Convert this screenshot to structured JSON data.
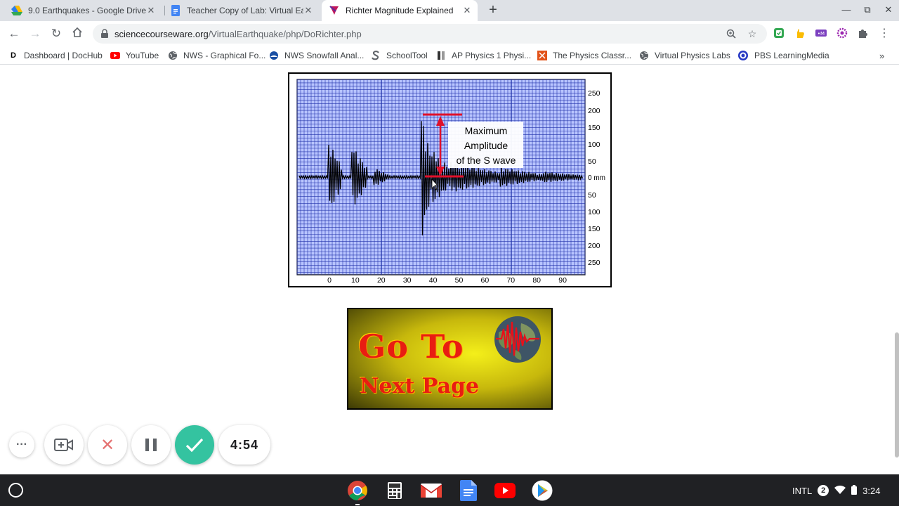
{
  "browser": {
    "tabs": [
      {
        "title": "9.0 Earthquakes - Google Drive",
        "icon": "google-drive-icon"
      },
      {
        "title": "Teacher Copy of Lab: Virtual Ear",
        "icon": "google-docs-icon"
      },
      {
        "title": "Richter Magnitude Explained",
        "icon": "sciencecourseware-icon",
        "active": true
      }
    ],
    "url_domain": "sciencecourseware.org",
    "url_path": "/VirtualEarthquake/php/DoRichter.php",
    "bookmarks": [
      {
        "label": "Dashboard | DocHub",
        "icon": "dochub-icon"
      },
      {
        "label": "YouTube",
        "icon": "youtube-icon"
      },
      {
        "label": "NWS - Graphical Fo...",
        "icon": "globe-icon"
      },
      {
        "label": "NWS Snowfall Anal...",
        "icon": "noaa-icon"
      },
      {
        "label": "SchoolTool",
        "icon": "schooltool-icon"
      },
      {
        "label": "AP Physics 1 Physi...",
        "icon": "physics-icon"
      },
      {
        "label": "The Physics Classr...",
        "icon": "physics-classroom-icon"
      },
      {
        "label": "Virtual Physics Labs",
        "icon": "globe-icon"
      },
      {
        "label": "PBS LearningMedia",
        "icon": "pbs-icon"
      }
    ]
  },
  "seismogram": {
    "annotation": [
      "Maximum",
      "Amplitude",
      "of the S wave"
    ],
    "y_labels_top": [
      "250",
      "200",
      "150",
      "100",
      "50"
    ],
    "zero_label": "0 mm",
    "y_labels_bottom": [
      "50",
      "100",
      "150",
      "200",
      "250"
    ],
    "x_labels": [
      "0",
      "10",
      "20",
      "30",
      "40",
      "50",
      "60",
      "70",
      "80",
      "90"
    ],
    "colors": {
      "grid": "#2233aa",
      "fill": "#b8c4ff",
      "trace": "#000000",
      "marker": "#e0102a"
    }
  },
  "next_button": {
    "line1": "Go To",
    "line2": "Next Page"
  },
  "recorder": {
    "timer": "4:54"
  },
  "shelf": {
    "keyboard": "INTL",
    "notifications": "2",
    "time": "3:24"
  }
}
